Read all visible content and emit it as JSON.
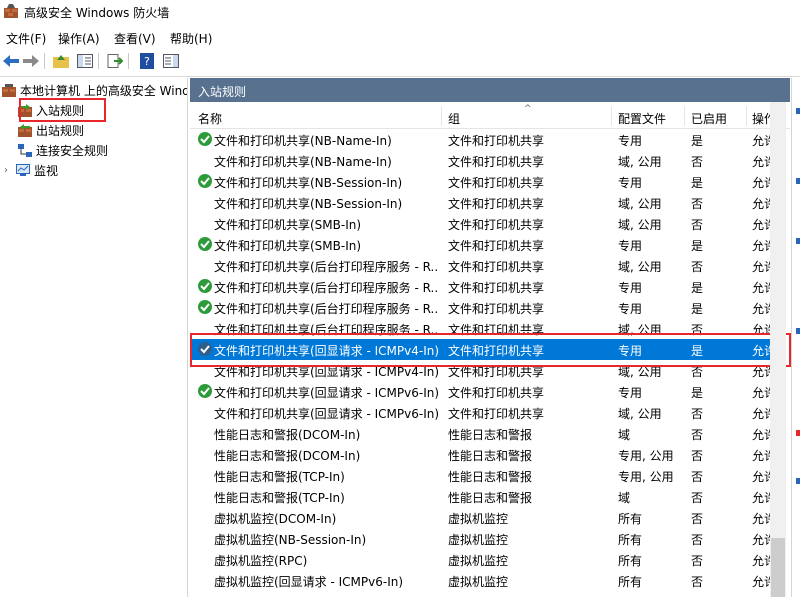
{
  "window": {
    "title": "高级安全 Windows 防火墙"
  },
  "menu": [
    "文件(F)",
    "操作(A)",
    "查看(V)",
    "帮助(H)"
  ],
  "tree": {
    "root": "本地计算机 上的高级安全 Wind",
    "items": [
      {
        "label": "入站规则",
        "icon": "inbound-rules-icon"
      },
      {
        "label": "出站规则",
        "icon": "outbound-rules-icon"
      },
      {
        "label": "连接安全规则",
        "icon": "connection-security-icon"
      },
      {
        "label": "监视",
        "icon": "monitor-icon"
      }
    ]
  },
  "panel": {
    "title": "入站规则",
    "columns": [
      "名称",
      "组",
      "配置文件",
      "已启用",
      "操作"
    ]
  },
  "rows": [
    {
      "enabled_icon": true,
      "name": "文件和打印机共享(NB-Name-In)",
      "group": "文件和打印机共享",
      "profile": "专用",
      "enabled": "是",
      "action": "允许"
    },
    {
      "enabled_icon": false,
      "name": "文件和打印机共享(NB-Name-In)",
      "group": "文件和打印机共享",
      "profile": "域, 公用",
      "enabled": "否",
      "action": "允许"
    },
    {
      "enabled_icon": true,
      "name": "文件和打印机共享(NB-Session-In)",
      "group": "文件和打印机共享",
      "profile": "专用",
      "enabled": "是",
      "action": "允许"
    },
    {
      "enabled_icon": false,
      "name": "文件和打印机共享(NB-Session-In)",
      "group": "文件和打印机共享",
      "profile": "域, 公用",
      "enabled": "否",
      "action": "允许"
    },
    {
      "enabled_icon": false,
      "name": "文件和打印机共享(SMB-In)",
      "group": "文件和打印机共享",
      "profile": "域, 公用",
      "enabled": "否",
      "action": "允许"
    },
    {
      "enabled_icon": true,
      "name": "文件和打印机共享(SMB-In)",
      "group": "文件和打印机共享",
      "profile": "专用",
      "enabled": "是",
      "action": "允许"
    },
    {
      "enabled_icon": false,
      "name": "文件和打印机共享(后台打印程序服务 - R...",
      "group": "文件和打印机共享",
      "profile": "域, 公用",
      "enabled": "否",
      "action": "允许"
    },
    {
      "enabled_icon": true,
      "name": "文件和打印机共享(后台打印程序服务 - R...",
      "group": "文件和打印机共享",
      "profile": "专用",
      "enabled": "是",
      "action": "允许"
    },
    {
      "enabled_icon": true,
      "name": "文件和打印机共享(后台打印程序服务 - R...",
      "group": "文件和打印机共享",
      "profile": "专用",
      "enabled": "是",
      "action": "允许"
    },
    {
      "enabled_icon": false,
      "name": "文件和打印机共享(后台打印程序服务 - R...",
      "group": "文件和打印机共享",
      "profile": "域, 公用",
      "enabled": "否",
      "action": "允许"
    },
    {
      "enabled_icon": true,
      "name": "文件和打印机共享(回显请求 - ICMPv4-In)",
      "group": "文件和打印机共享",
      "profile": "专用",
      "enabled": "是",
      "action": "允许",
      "selected": true
    },
    {
      "enabled_icon": false,
      "name": "文件和打印机共享(回显请求 - ICMPv4-In)",
      "group": "文件和打印机共享",
      "profile": "域, 公用",
      "enabled": "否",
      "action": "允许"
    },
    {
      "enabled_icon": true,
      "name": "文件和打印机共享(回显请求 - ICMPv6-In)",
      "group": "文件和打印机共享",
      "profile": "专用",
      "enabled": "是",
      "action": "允许"
    },
    {
      "enabled_icon": false,
      "name": "文件和打印机共享(回显请求 - ICMPv6-In)",
      "group": "文件和打印机共享",
      "profile": "域, 公用",
      "enabled": "否",
      "action": "允许"
    },
    {
      "enabled_icon": false,
      "name": "性能日志和警报(DCOM-In)",
      "group": "性能日志和警报",
      "profile": "域",
      "enabled": "否",
      "action": "允许"
    },
    {
      "enabled_icon": false,
      "name": "性能日志和警报(DCOM-In)",
      "group": "性能日志和警报",
      "profile": "专用, 公用",
      "enabled": "否",
      "action": "允许"
    },
    {
      "enabled_icon": false,
      "name": "性能日志和警报(TCP-In)",
      "group": "性能日志和警报",
      "profile": "专用, 公用",
      "enabled": "否",
      "action": "允许"
    },
    {
      "enabled_icon": false,
      "name": "性能日志和警报(TCP-In)",
      "group": "性能日志和警报",
      "profile": "域",
      "enabled": "否",
      "action": "允许"
    },
    {
      "enabled_icon": false,
      "name": "虚拟机监控(DCOM-In)",
      "group": "虚拟机监控",
      "profile": "所有",
      "enabled": "否",
      "action": "允许"
    },
    {
      "enabled_icon": false,
      "name": "虚拟机监控(NB-Session-In)",
      "group": "虚拟机监控",
      "profile": "所有",
      "enabled": "否",
      "action": "允许"
    },
    {
      "enabled_icon": false,
      "name": "虚拟机监控(RPC)",
      "group": "虚拟机监控",
      "profile": "所有",
      "enabled": "否",
      "action": "允许"
    },
    {
      "enabled_icon": false,
      "name": "虚拟机监控(回显请求 - ICMPv6-In)",
      "group": "虚拟机监控",
      "profile": "所有",
      "enabled": "否",
      "action": "允许"
    }
  ],
  "colors": {
    "header": "#57718f",
    "selection": "#0078d7",
    "highlight_box": "#e8262b",
    "enabled_check": "#2e9b3a"
  }
}
